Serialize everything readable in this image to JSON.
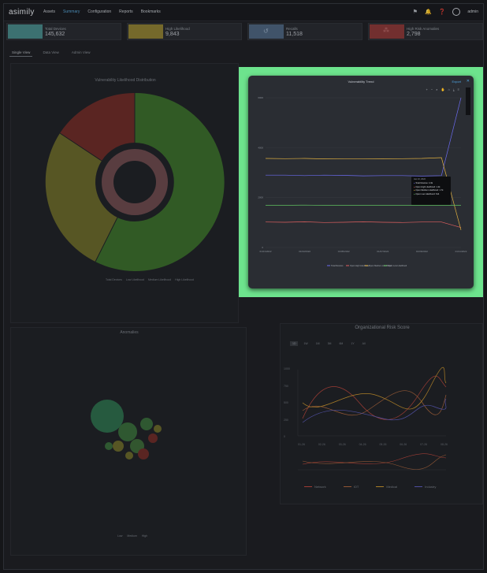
{
  "app": {
    "logo": "asimily"
  },
  "nav": {
    "items": [
      "Assets",
      "Summary",
      "Configuration",
      "Reports",
      "Bookmarks"
    ],
    "active": 1
  },
  "user": {
    "name": "admin"
  },
  "cards": [
    {
      "label": "Total Devices",
      "value": "145,632",
      "color": "#4a8a8a"
    },
    {
      "label": "High Likelihood",
      "value": "9,843",
      "color": "#9a8a3a"
    },
    {
      "label": "Recalls",
      "value": "11,518",
      "color": "#4f6680"
    },
    {
      "label": "High Risk Anomalies",
      "value": "2,798",
      "color": "#8b3a3a"
    }
  ],
  "tabs": [
    "Single View",
    "Data View",
    "Admin View"
  ],
  "panels": {
    "top_left_title": "Vulnerability Likelihood Distribution",
    "bottom_left_title": "Anomalies",
    "bottom_right_title": "Organizational Risk Score",
    "bottom_right_legend": [
      "Network",
      "IOT",
      "Medical",
      "Industry"
    ],
    "bottom_right_x_labels": [
      "01-26",
      "02-26",
      "03-26",
      "04-26",
      "05-26",
      "06-26",
      "07-26",
      "08-26"
    ],
    "bottom_right_y_labels": [
      "0",
      "250",
      "500",
      "750",
      "1000"
    ],
    "sunburst_legend": [
      "Total Devices",
      "Low Likelihood",
      "Medium Likelihood",
      "High Likelihood"
    ],
    "bubble_legend": [
      "Low",
      "Medium",
      "High"
    ],
    "range_buttons": [
      "1D",
      "1W",
      "1M",
      "3M",
      "6M",
      "1Y",
      "All"
    ]
  },
  "modal": {
    "title": "Vulnerability Trend",
    "export": "Export",
    "close": "Close",
    "toolbar_icons": [
      "zoom-in-icon",
      "zoom-out-icon",
      "zoom-area-icon",
      "pan-icon",
      "reset-icon",
      "download-icon",
      "menu-icon"
    ],
    "tooltip": {
      "title": "Jan 10, 2022",
      "rows": [
        {
          "label": "Total Devices",
          "value": "4.3k",
          "color": "#6b6bf0"
        },
        {
          "label": "Open High Likelihood",
          "value": "1.2k",
          "color": "#e06060"
        },
        {
          "label": "Open Medium Likelihood",
          "value": "1.7k",
          "color": "#e0b040"
        },
        {
          "label": "Open Low Likelihood",
          "value": "614",
          "color": "#60c060"
        }
      ]
    }
  },
  "chart_data": {
    "type": "line",
    "x": [
      "01/01/2022",
      "01/02/2022",
      "01/03/2022",
      "01/04/2022",
      "01/05/2022",
      "01/06/2022",
      "01/07/2022",
      "01/08/2022",
      "01/09/2022",
      "01/10/2022",
      "01/11/2022"
    ],
    "x_labels": [
      "01/01/2022",
      "01/03/2022",
      "01/05/2022",
      "01/07/2022",
      "01/09/2022",
      "01/11/2022"
    ],
    "y_ticks": [
      "0",
      "2000",
      "4000",
      "6000"
    ],
    "ylim": [
      0,
      6000
    ],
    "series": [
      {
        "name": "Total Devices",
        "color": "#6b6bf0",
        "values": [
          2900,
          2900,
          2880,
          2900,
          2890,
          2870,
          2880,
          2880,
          2860,
          2880,
          6300
        ]
      },
      {
        "name": "Open High Likelihood",
        "color": "#e06060",
        "values": [
          1020,
          1010,
          1030,
          1000,
          1010,
          1030,
          1010,
          1000,
          1020,
          1020,
          800
        ]
      },
      {
        "name": "Open Medium Likelihood",
        "color": "#e0b040",
        "values": [
          3570,
          3560,
          3570,
          3550,
          3560,
          3560,
          3550,
          3560,
          3570,
          3600,
          700
        ]
      },
      {
        "name": "Open Low Likelihood",
        "color": "#60c060",
        "values": [
          1690,
          1690,
          1700,
          1690,
          1690,
          1690,
          1690,
          1690,
          1690,
          1690,
          1690
        ]
      }
    ]
  }
}
